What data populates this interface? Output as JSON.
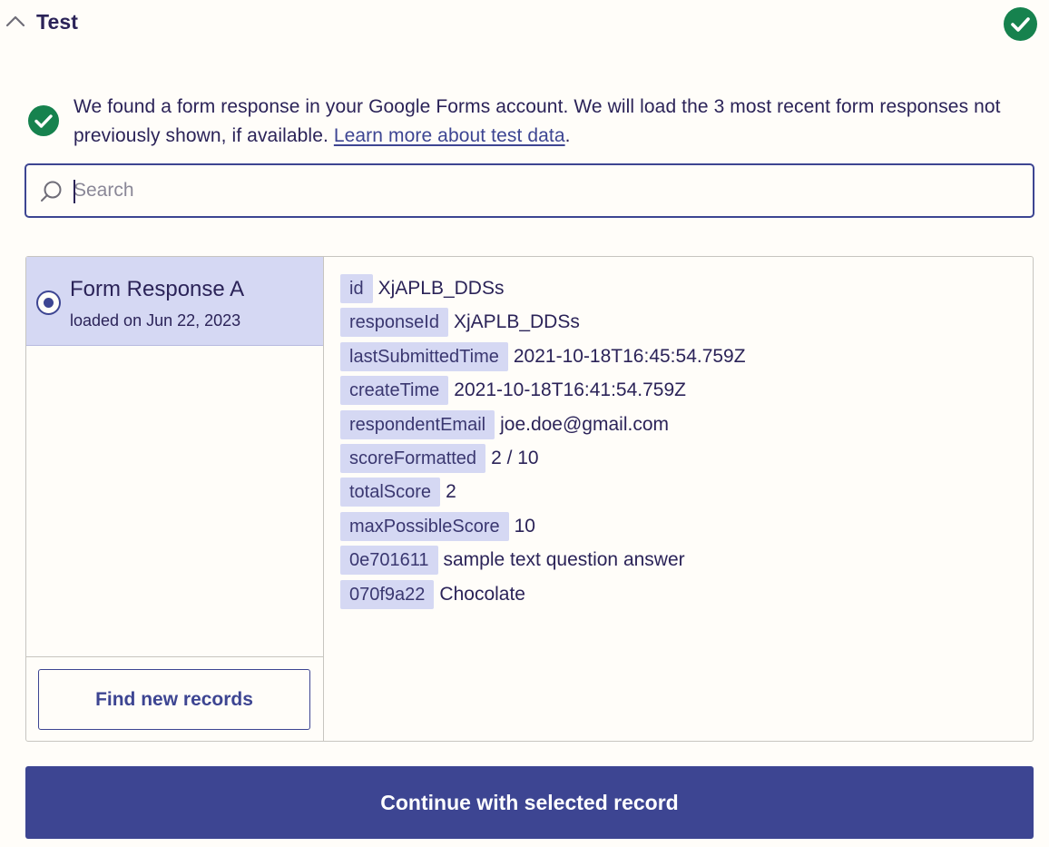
{
  "header": {
    "title": "Test",
    "collapse_icon": "chevron-up-icon",
    "status_icon": "check-circle-icon",
    "status_color": "#16824e"
  },
  "info": {
    "icon": "check-circle-icon",
    "message": "We found a form response in your Google Forms account. We will load the 3 most recent form responses not previously shown, if available. ",
    "link_text": "Learn more about test data",
    "trailing": "."
  },
  "search": {
    "placeholder": "Search",
    "value": "",
    "icon": "search-icon"
  },
  "records": [
    {
      "title": "Form Response A",
      "subtitle": "loaded on Jun 22, 2023",
      "selected": true
    }
  ],
  "find_button_label": "Find new records",
  "fields": [
    {
      "key": "id",
      "value": "XjAPLB_DDSs"
    },
    {
      "key": "responseId",
      "value": "XjAPLB_DDSs"
    },
    {
      "key": "lastSubmittedTime",
      "value": "2021-10-18T16:45:54.759Z"
    },
    {
      "key": "createTime",
      "value": "2021-10-18T16:41:54.759Z"
    },
    {
      "key": "respondentEmail",
      "value": "joe.doe@gmail.com"
    },
    {
      "key": "scoreFormatted",
      "value": "2 / 10"
    },
    {
      "key": "totalScore",
      "value": "2"
    },
    {
      "key": "maxPossibleScore",
      "value": "10"
    },
    {
      "key": "0e701611",
      "value": "sample text question answer"
    },
    {
      "key": "070f9a22",
      "value": "Chocolate"
    }
  ],
  "continue_button_label": "Continue with selected record",
  "colors": {
    "accent": "#3d4592",
    "selected_bg": "#d5d8f3",
    "success": "#16824e",
    "background": "#fffdf9"
  }
}
